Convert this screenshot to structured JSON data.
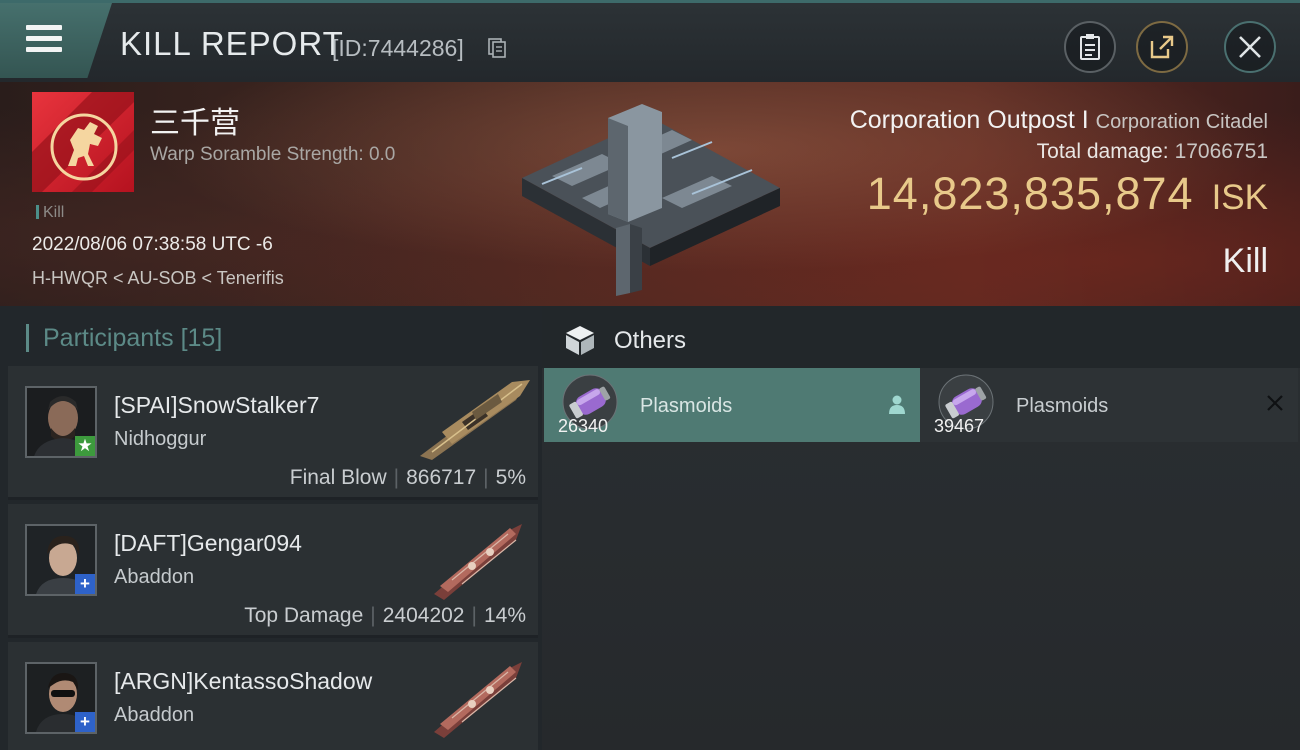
{
  "header": {
    "title": "KILL REPORT",
    "report_id": "[ID:7444286]",
    "menu_icon": "hamburger-menu-icon",
    "buttons": {
      "clipboard_icon": "clipboard-icon",
      "share_icon": "share-external-icon",
      "close_icon": "close-icon"
    }
  },
  "victim": {
    "name": "三千营",
    "warp_scramble": "Warp Soramble Strength: 0.0",
    "kill_tag": "Kill",
    "timestamp": "2022/08/06 07:38:58 UTC -6",
    "location": "H-HWQR < AU-SOB < Tenerifis",
    "structure_name": "Corporation Outpost I",
    "structure_class": "Corporation Citadel",
    "total_damage_label": "Total damage:",
    "total_damage_value": "17066751",
    "isk_value": "14,823,835,874",
    "isk_unit": "ISK",
    "result_label": "Kill",
    "logo_color": "#d3232f"
  },
  "participants": {
    "label": "Participants",
    "count": "[15]",
    "items": [
      {
        "name": "[SPAI]SnowStalker7",
        "ship": "Nidhoggur",
        "role": "Final Blow",
        "damage": "866717",
        "percent": "5%",
        "badge": "★"
      },
      {
        "name": "[DAFT]Gengar094",
        "ship": "Abaddon",
        "role": "Top Damage",
        "damage": "2404202",
        "percent": "14%",
        "badge": "+"
      },
      {
        "name": "[ARGN]KentassoShadow",
        "ship": "Abaddon",
        "badge": "+"
      }
    ]
  },
  "others": {
    "title": "Others",
    "items": [
      {
        "name": "Plasmoids",
        "quantity": "26340",
        "selected": true
      },
      {
        "name": "Plasmoids",
        "quantity": "39467",
        "selected": false
      }
    ]
  },
  "colors": {
    "accent_teal": "#4f7a73",
    "isk_gold": "#e8c98a",
    "participants_label": "#5c8a87"
  }
}
